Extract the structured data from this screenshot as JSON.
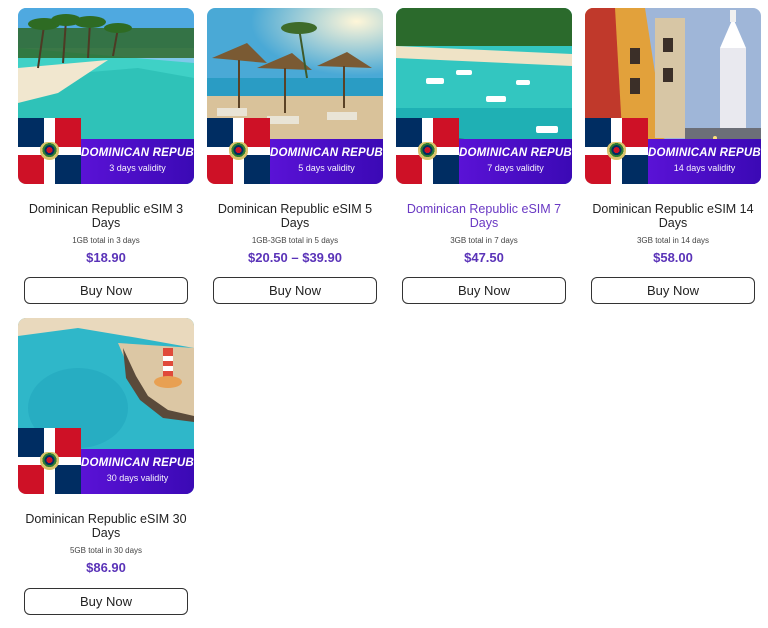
{
  "products": [
    {
      "title": "Dominican Republic eSIM 3 Days",
      "banner_country": "DOMINICAN REPUBLIC",
      "banner_validity": "3 days validity",
      "data": "1GB total in 3 days",
      "price": "$18.90",
      "button": "Buy Now"
    },
    {
      "title": "Dominican Republic eSIM 5 Days",
      "banner_country": "DOMINICAN REPUBLIC",
      "banner_validity": "5 days validity",
      "data": "1GB-3GB total in 5 days",
      "price": "$20.50 – $39.90",
      "button": "Buy Now"
    },
    {
      "title": "Dominican Republic eSIM 7 Days",
      "banner_country": "DOMINICAN REPUBLIC",
      "banner_validity": "7 days validity",
      "data": "3GB total in 7 days",
      "price": "$47.50",
      "button": "Buy Now"
    },
    {
      "title": "Dominican Republic eSIM 14 Days",
      "banner_country": "DOMINICAN REPUBLIC",
      "banner_validity": "14 days validity",
      "data": "3GB total in 14 days",
      "price": "$58.00",
      "button": "Buy Now"
    },
    {
      "title": "Dominican Republic eSIM 30 Days",
      "banner_country": "DOMINICAN REPUBLIC",
      "banner_validity": "30 days validity",
      "data": "5GB total in 30 days",
      "price": "$86.90",
      "button": "Buy Now"
    }
  ],
  "colors": {
    "price": "#5a33b8",
    "hover_title": "#6a39c4",
    "banner": "#4a0fc8",
    "flag_blue": "#002d62",
    "flag_red": "#ce1126"
  }
}
